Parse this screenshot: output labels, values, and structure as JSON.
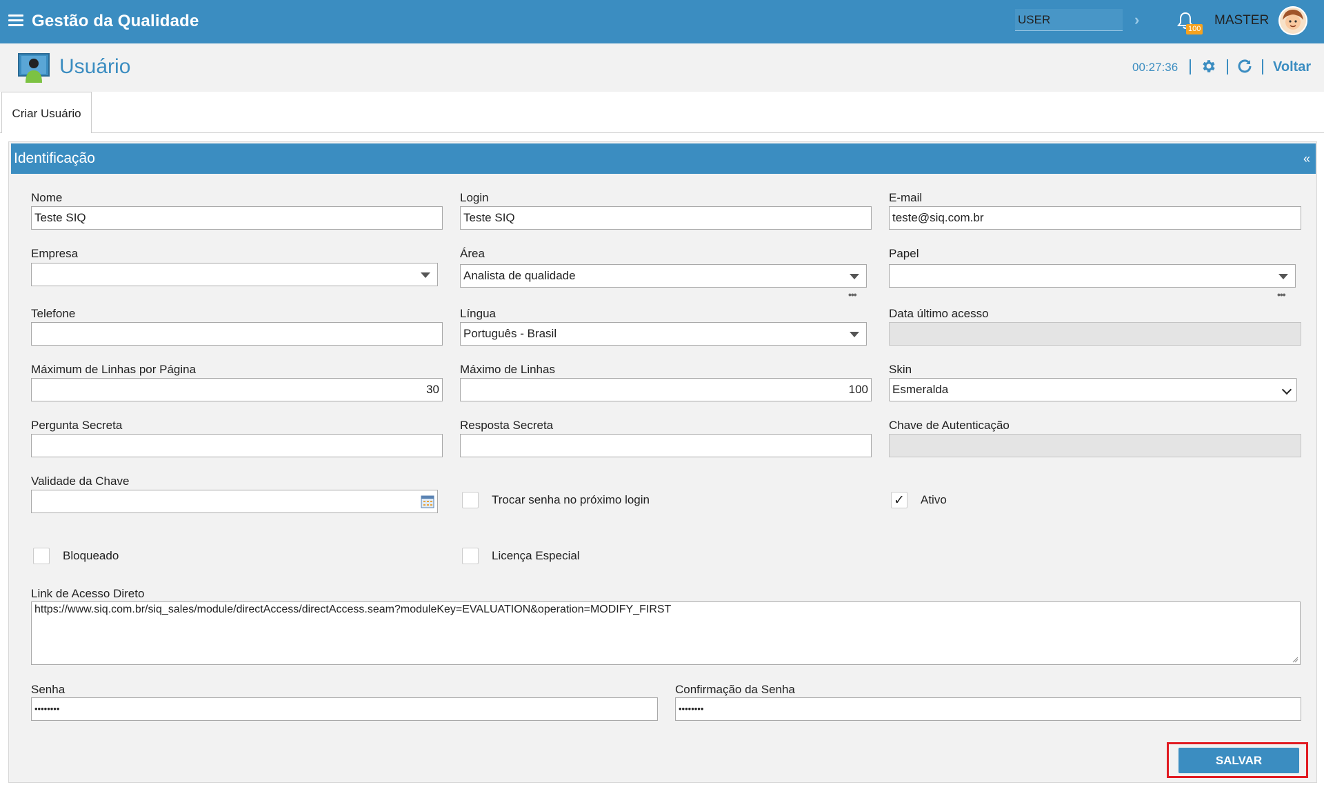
{
  "header": {
    "app_title": "Gestão da Qualidade",
    "user_select_value": "USER",
    "notification_count": "100",
    "user_name": "MASTER"
  },
  "page": {
    "title": "Usuário",
    "timer": "00:27:36",
    "back_label": "Voltar",
    "tab_label": "Criar Usuário"
  },
  "section": {
    "title": "Identificação",
    "collapse_glyph": "«"
  },
  "form": {
    "nome": {
      "label": "Nome",
      "value": "Teste SIQ"
    },
    "login": {
      "label": "Login",
      "value": "Teste SIQ"
    },
    "email": {
      "label": "E-mail",
      "value": "teste@siq.com.br"
    },
    "empresa": {
      "label": "Empresa",
      "value": ""
    },
    "area": {
      "label": "Área",
      "value": "Analista de qualidade"
    },
    "papel": {
      "label": "Papel",
      "value": ""
    },
    "telefone": {
      "label": "Telefone",
      "value": ""
    },
    "lingua": {
      "label": "Língua",
      "value": "Português - Brasil"
    },
    "data_ultimo_acesso": {
      "label": "Data último acesso",
      "value": ""
    },
    "max_linhas_pagina": {
      "label": "Máximum de Linhas por Página",
      "value": "30"
    },
    "max_linhas": {
      "label": "Máximo de Linhas",
      "value": "100"
    },
    "skin": {
      "label": "Skin",
      "value": "Esmeralda"
    },
    "pergunta_secreta": {
      "label": "Pergunta Secreta",
      "value": ""
    },
    "resposta_secreta": {
      "label": "Resposta Secreta",
      "value": ""
    },
    "chave_autenticacao": {
      "label": "Chave de Autenticação",
      "value": ""
    },
    "validade_chave": {
      "label": "Validade da Chave",
      "value": ""
    },
    "trocar_senha": {
      "label": "Trocar senha no próximo login",
      "checked": false
    },
    "ativo": {
      "label": "Ativo",
      "checked": true,
      "check_glyph": "✓"
    },
    "bloqueado": {
      "label": "Bloqueado",
      "checked": false
    },
    "licenca_especial": {
      "label": "Licença Especial",
      "checked": false
    },
    "link_acesso_direto": {
      "label": "Link de Acesso Direto",
      "value": "https://www.siq.com.br/siq_sales/module/directAccess/directAccess.seam?moduleKey=EVALUATION&operation=MODIFY_FIRST"
    },
    "senha": {
      "label": "Senha",
      "value": "••••••••"
    },
    "confirmacao_senha": {
      "label": "Confirmação da Senha",
      "value": "••••••••"
    },
    "lookup_dots": "•••"
  },
  "actions": {
    "save_label": "SALVAR"
  },
  "colors": {
    "primary": "#3b8dc1",
    "badge": "#f6a21e",
    "highlight_frame": "#e11b22",
    "panel_bg": "#f2f2f2"
  },
  "icons": [
    "menu-icon",
    "chevron-right-icon",
    "bell-icon",
    "user-avatar",
    "user-screen-icon",
    "gear-icon",
    "refresh-icon",
    "calendar-icon",
    "dropdown-arrow-icon"
  ]
}
